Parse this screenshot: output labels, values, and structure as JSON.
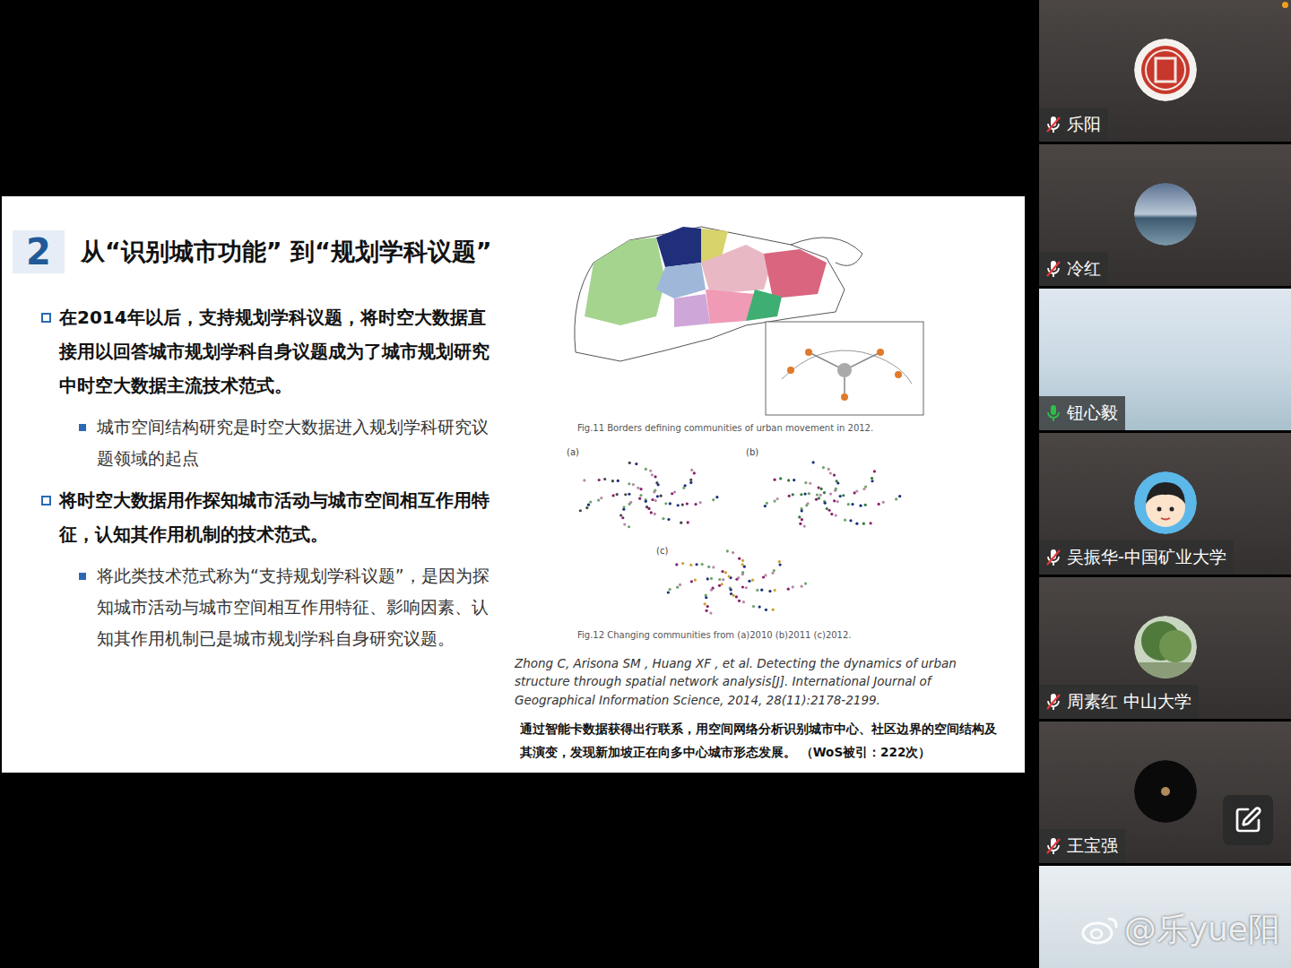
{
  "slide": {
    "number": "2",
    "title": "从“识别城市功能” 到“规划学科议题”",
    "points": [
      {
        "kind": "main",
        "text": "在2014年以后，支持规划学科议题，将时空大数据直接用以回答城市规划学科自身议题成为了城市规划研究中时空大数据主流技术范式。"
      },
      {
        "kind": "sub",
        "text": "城市空间结构研究是时空大数据进入规划学科研究议题领域的起点"
      },
      {
        "kind": "main",
        "text": "将时空大数据用作探知城市活动与城市空间相互作用特征，认知其作用机制的技术范式。"
      },
      {
        "kind": "sub",
        "text": "将此类技术范式称为“支持规划学科议题”，是因为探知城市活动与城市空间相互作用特征、影响因素、认知其作用机制已是城市规划学科自身研究议题。"
      }
    ],
    "figures": [
      {
        "caption": "Fig.11 Borders defining communities of urban movement in 2012.",
        "labels": []
      },
      {
        "caption": "Fig.12 Changing communities from (a)2010 (b)2011 (c)2012.",
        "labels": [
          "(a)",
          "(b)",
          "(c)"
        ]
      }
    ],
    "reference": "Zhong C, Arisona SM , Huang XF , et al. Detecting the dynamics of urban structure through spatial network analysis[J]. International Journal of Geographical Information Science, 2014, 28(11):2178-2199.",
    "summary": "通过智能卡数据获得出行联系，用空间网络分析识别城市中心、社区边界的空间结构及其演变，发现新加坡正在向多中心城市形态发展。",
    "citation": "（WoS被引：222次）"
  },
  "participants": [
    {
      "name": "乐阳",
      "kind": "avatar",
      "muted": true
    },
    {
      "name": "冷红",
      "kind": "avatar",
      "muted": true
    },
    {
      "name": "钮心毅",
      "kind": "video",
      "muted": false
    },
    {
      "name": "吴振华-中国矿业大学",
      "kind": "avatar",
      "muted": true
    },
    {
      "name": "周素红 中山大学",
      "kind": "avatar",
      "muted": true
    },
    {
      "name": "王宝强",
      "kind": "avatar",
      "muted": true
    },
    {
      "name": "",
      "kind": "video",
      "muted": true
    }
  ],
  "watermark": "@乐yue阳"
}
